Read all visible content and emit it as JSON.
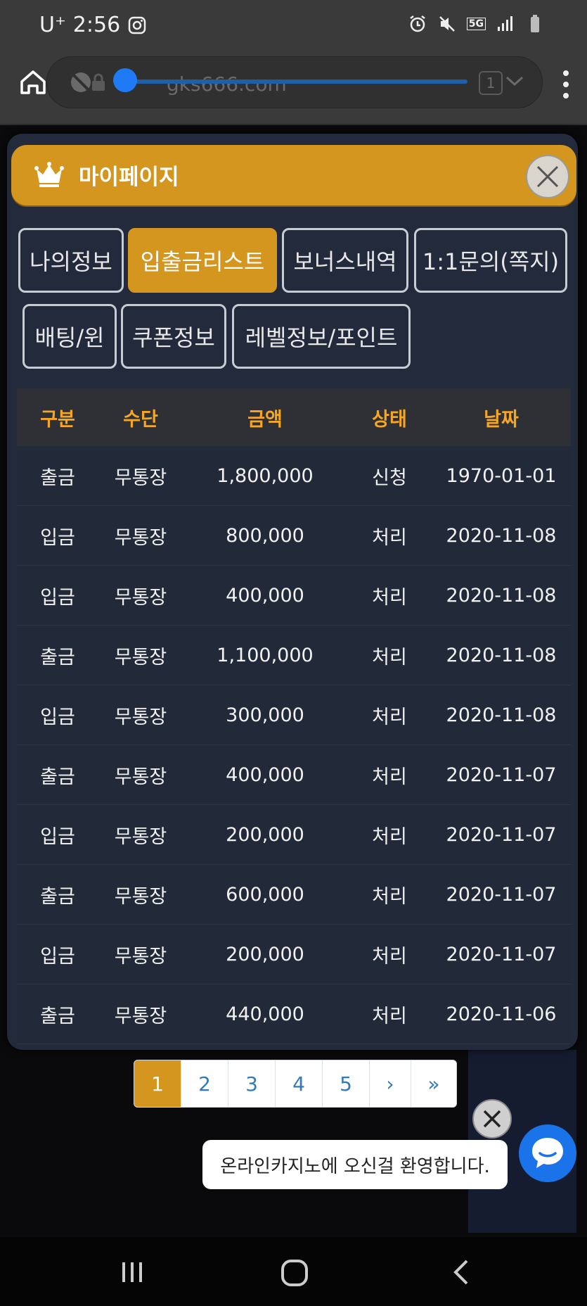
{
  "status_bar": {
    "carrier": "U⁺",
    "time": "2:56",
    "network": "5G"
  },
  "browser": {
    "url": "gks666.com",
    "tab_count": "1"
  },
  "modal": {
    "title": "마이페이지"
  },
  "tabs": [
    {
      "label": "나의정보"
    },
    {
      "label": "입출금리스트"
    },
    {
      "label": "보너스내역"
    },
    {
      "label": "1:1문의(쪽지)"
    },
    {
      "label": "배팅/윈"
    },
    {
      "label": "쿠폰정보"
    },
    {
      "label": "레벨정보/포인트"
    }
  ],
  "table": {
    "headers": [
      "구분",
      "수단",
      "금액",
      "상태",
      "날짜"
    ],
    "rows": [
      [
        "출금",
        "무통장",
        "1,800,000",
        "신청",
        "1970-01-01"
      ],
      [
        "입금",
        "무통장",
        "800,000",
        "처리",
        "2020-11-08"
      ],
      [
        "입금",
        "무통장",
        "400,000",
        "처리",
        "2020-11-08"
      ],
      [
        "출금",
        "무통장",
        "1,100,000",
        "처리",
        "2020-11-08"
      ],
      [
        "입금",
        "무통장",
        "300,000",
        "처리",
        "2020-11-08"
      ],
      [
        "출금",
        "무통장",
        "400,000",
        "처리",
        "2020-11-07"
      ],
      [
        "입금",
        "무통장",
        "200,000",
        "처리",
        "2020-11-07"
      ],
      [
        "출금",
        "무통장",
        "600,000",
        "처리",
        "2020-11-07"
      ],
      [
        "입금",
        "무통장",
        "200,000",
        "처리",
        "2020-11-07"
      ],
      [
        "출금",
        "무통장",
        "440,000",
        "처리",
        "2020-11-06"
      ]
    ]
  },
  "pagination": [
    "1",
    "2",
    "3",
    "4",
    "5",
    "›",
    "»"
  ],
  "toast": {
    "message": "온라인카지노에 오신걸 환영합니다."
  },
  "colors": {
    "accent": "#d4961f",
    "modal_bg": "#232a3b",
    "header_text": "#f5a623",
    "link": "#337ab7"
  },
  "icons": [
    "home-icon",
    "crown-icon",
    "close-icon",
    "chat-icon",
    "alarm-icon",
    "mute-icon",
    "signal-icon",
    "battery-icon",
    "instagram-icon"
  ]
}
